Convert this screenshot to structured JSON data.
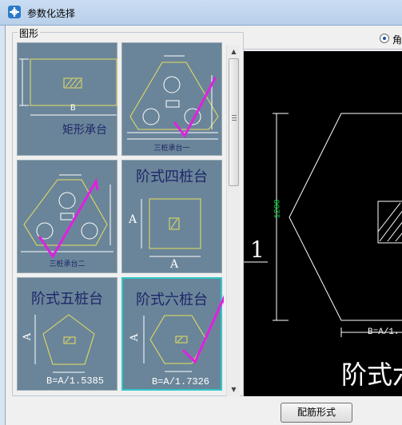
{
  "window": {
    "title": "参数化选择",
    "icon": "app-icon"
  },
  "group": {
    "label": "图形"
  },
  "tiles": [
    {
      "caption": "矩形承台",
      "sub": "",
      "dim_label": "B"
    },
    {
      "caption": "",
      "sub": "三桩承台一",
      "dim_label": ""
    },
    {
      "caption": "",
      "sub": "三桩承台二",
      "dim_label": ""
    },
    {
      "caption": "阶式四桩台",
      "sub": "",
      "dim_label": "A"
    },
    {
      "caption": "阶式五桩台",
      "sub": "",
      "dim_label": "A",
      "formula": "B=A/1.5385"
    },
    {
      "caption": "阶式六桩台",
      "sub": "",
      "dim_label": "A",
      "formula": "B=A/1.7326"
    }
  ],
  "radio": {
    "label": "角",
    "checked": true
  },
  "preview": {
    "title": "阶式六",
    "side_label": "1",
    "dimension": "1200",
    "formula": "B=A/1."
  },
  "button": {
    "label": "配筋形式"
  },
  "colors": {
    "tile_bg": "#6a8599",
    "selected_border": "#31c7ca",
    "preview_bg": "#000000",
    "annotation": "#e020e0"
  }
}
